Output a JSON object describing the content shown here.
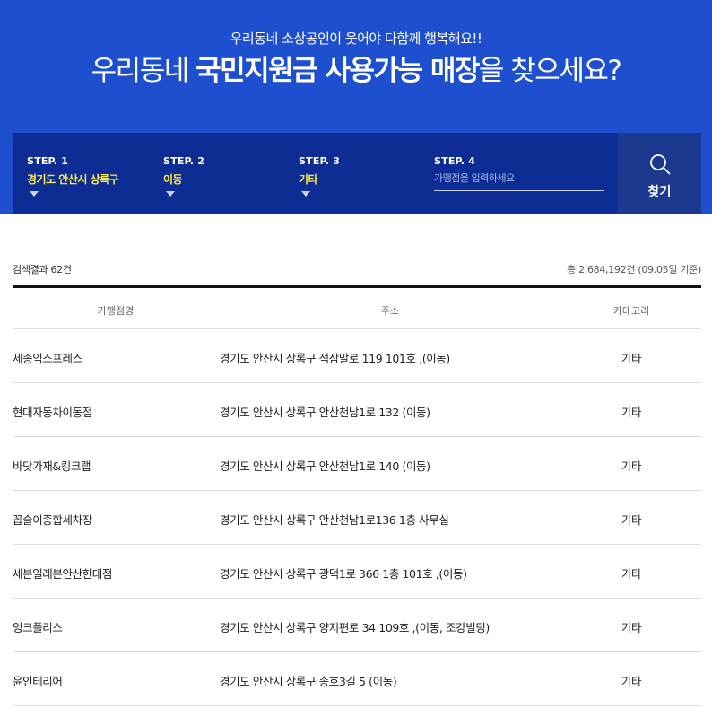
{
  "hero": {
    "subtitle": "우리동네 소상공인이 웃어야 다함께 행복해요!!",
    "title_pre": "우리동네 ",
    "title_bold1": "국민지원금 사용가능 매장",
    "title_post": "을 찾으세요?"
  },
  "search": {
    "steps": [
      {
        "label": "STEP. 1",
        "value": "경기도 안산시 상록구"
      },
      {
        "label": "STEP. 2",
        "value": "이동"
      },
      {
        "label": "STEP. 3",
        "value": "기타"
      },
      {
        "label": "STEP. 4",
        "placeholder": "가맹점을 입력하세요"
      }
    ],
    "button_label": "찾기",
    "icon": "search-icon"
  },
  "results": {
    "count_text": "검색결과 62건",
    "total_text": "총 2,684,192건 (09.05일 기준)",
    "columns": [
      "가맹점명",
      "주소",
      "카테고리"
    ],
    "rows": [
      {
        "name": "세종익스프레스",
        "address": "경기도 안산시 상록구 석삼말로 119 101호 ,(이동)",
        "category": "기타"
      },
      {
        "name": "현대자동차이동점",
        "address": "경기도 안산시 상록구 안산천남1로 132 (이동)",
        "category": "기타"
      },
      {
        "name": "바닷가재&킹크랩",
        "address": "경기도 안산시 상록구 안산천남1로 140 (이동)",
        "category": "기타"
      },
      {
        "name": "꼽슬이종합세차장",
        "address": "경기도 안산시 상록구 안산천남1로136 1층 사무실",
        "category": "기타"
      },
      {
        "name": "세븐일레븐안산한대점",
        "address": "경기도 안산시 상록구 광덕1로 366 1층 101호 ,(이동)",
        "category": "기타"
      },
      {
        "name": "잉크플리스",
        "address": "경기도 안산시 상록구 양지편로 34 109호 ,(이동, 조강빌딩)",
        "category": "기타"
      },
      {
        "name": "윤인테리어",
        "address": "경기도 안산시 상록구 송호3길 5 (이동)",
        "category": "기타"
      }
    ]
  },
  "colors": {
    "hero_bg": "#1d4fce",
    "panel_bg": "#0d2d94",
    "button_bg": "#1b3a8f",
    "highlight": "#ffe94a"
  }
}
